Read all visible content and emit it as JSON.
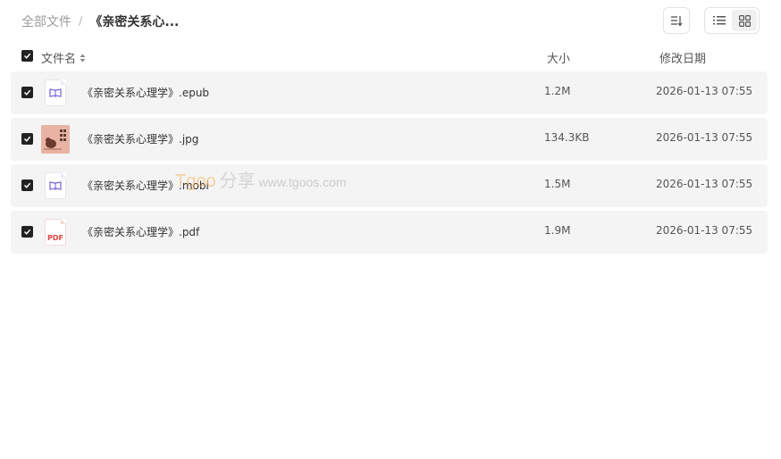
{
  "breadcrumb": {
    "root": "全部文件",
    "separator": "/",
    "current": "《亲密关系心..."
  },
  "toolbar": {
    "sort_icon": "sort-icon",
    "list_icon": "list-view-icon",
    "grid_icon": "grid-view-icon"
  },
  "columns": {
    "name": "文件名",
    "size": "大小",
    "date": "修改日期"
  },
  "files": [
    {
      "name": "《亲密关系心理学》.epub",
      "size": "1.2M",
      "date": "2026-01-13 07:55",
      "icon": "ebook-icon"
    },
    {
      "name": "《亲密关系心理学》.jpg",
      "size": "134.3KB",
      "date": "2026-01-13 07:55",
      "icon": "image-thumbnail"
    },
    {
      "name": "《亲密关系心理学》.mobi",
      "size": "1.5M",
      "date": "2026-01-13 07:55",
      "icon": "ebook-icon"
    },
    {
      "name": "《亲密关系心理学》.pdf",
      "size": "1.9M",
      "date": "2026-01-13 07:55",
      "icon": "pdf-icon",
      "icon_label": "PDF"
    }
  ],
  "watermark": {
    "brand": "Tgoo",
    "share": "分享",
    "url": "www.tgoos.com"
  },
  "colors": {
    "row_bg": "#f4f4f4",
    "checkbox": "#222222",
    "ebook_accent": "#7b6cd9",
    "pdf_red": "#e0443e"
  }
}
